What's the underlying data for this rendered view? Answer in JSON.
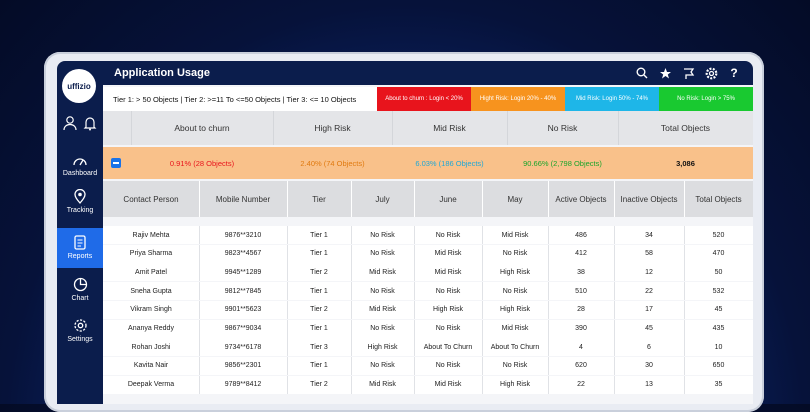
{
  "app": {
    "logo_text": "uffizio",
    "title": "Application Usage"
  },
  "sidebar": {
    "items": [
      {
        "label": "Dashboard",
        "icon": "dashboard-icon"
      },
      {
        "label": "Tracking",
        "icon": "location-icon"
      },
      {
        "label": "Reports",
        "icon": "reports-icon",
        "active": true
      },
      {
        "label": "Chart",
        "icon": "pie-chart-icon"
      },
      {
        "label": "Settings",
        "icon": "gear-icon"
      }
    ]
  },
  "tiers": {
    "text": "Tier 1: > 50 Objects | Tier 2: >=11 To <=50 Objects | Tier 3: <= 10 Objects",
    "legend": [
      {
        "label": "About to churn : Login < 20%",
        "color": "#e8141c"
      },
      {
        "label": "Hight Risk: Login 20% - 40%",
        "color": "#f7931e"
      },
      {
        "label": "Mid Risk: Login 50% - 74%",
        "color": "#1eb6e8"
      },
      {
        "label": "No Risk: Login > 75%",
        "color": "#19c930"
      }
    ]
  },
  "summary": {
    "headers": [
      "About to churn",
      "High Risk",
      "Mid Risk",
      "No Risk",
      "Total Objects"
    ],
    "values": [
      {
        "text": "0.91% (28 Objects)",
        "color": "#e8141c"
      },
      {
        "text": "2.40% (74 Objects)",
        "color": "#f7931e"
      },
      {
        "text": "6.03% (186 Objects)",
        "color": "#1eb6e8"
      },
      {
        "text": "90.66% (2,798 Objects)",
        "color": "#19c930"
      },
      {
        "text": "3,086",
        "color": "#111111"
      }
    ]
  },
  "table": {
    "headers": [
      "Contact Person",
      "Mobile Number",
      "Tier",
      "July",
      "June",
      "May",
      "Active Objects",
      "Inactive Objects",
      "Total Objects"
    ],
    "rows": [
      [
        "Rajiv Mehta",
        "9876**3210",
        "Tier 1",
        "No Risk",
        "No Risk",
        "Mid Risk",
        "486",
        "34",
        "520"
      ],
      [
        "Priya Sharma",
        "9823**4567",
        "Tier 1",
        "No Risk",
        "Mid Risk",
        "No Risk",
        "412",
        "58",
        "470"
      ],
      [
        "Amit Patel",
        "9945**1289",
        "Tier 2",
        "Mid Risk",
        "Mid Risk",
        "High Risk",
        "38",
        "12",
        "50"
      ],
      [
        "Sneha Gupta",
        "9812**7845",
        "Tier 1",
        "No Risk",
        "No Risk",
        "No Risk",
        "510",
        "22",
        "532"
      ],
      [
        "Vikram Singh",
        "9901**5623",
        "Tier 2",
        "Mid Risk",
        "High Risk",
        "High Risk",
        "28",
        "17",
        "45"
      ],
      [
        "Ananya Reddy",
        "9867**9034",
        "Tier 1",
        "No Risk",
        "No Risk",
        "Mid Risk",
        "390",
        "45",
        "435"
      ],
      [
        "Rohan Joshi",
        "9734**6178",
        "Tier 3",
        "High Risk",
        "About To Churn",
        "About To Churn",
        "4",
        "6",
        "10"
      ],
      [
        "Kavita Nair",
        "9856**2301",
        "Tier 1",
        "No Risk",
        "No Risk",
        "No Risk",
        "620",
        "30",
        "650"
      ],
      [
        "Deepak Verma",
        "9789**8412",
        "Tier 2",
        "Mid Risk",
        "Mid Risk",
        "High Risk",
        "22",
        "13",
        "35"
      ]
    ]
  }
}
